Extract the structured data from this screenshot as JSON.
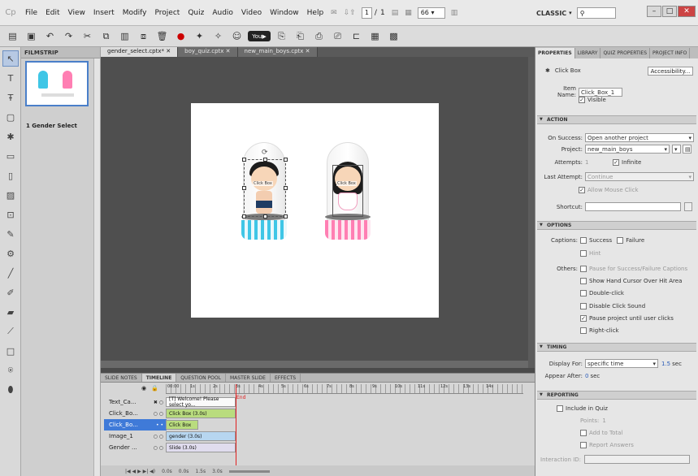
{
  "menubar": {
    "logo": "Cp",
    "items": [
      "File",
      "Edit",
      "View",
      "Insert",
      "Modify",
      "Project",
      "Quiz",
      "Audio",
      "Video",
      "Window",
      "Help"
    ],
    "page_current": "1",
    "page_sep": "/",
    "page_total": "1",
    "zoom": "66",
    "workspace": "CLASSIC",
    "search_icon": "search-icon"
  },
  "filmstrip": {
    "title": "FILMSTRIP",
    "slide_name": "1 Gender Select"
  },
  "doc_tabs": [
    "gender_select.cptx*",
    "boy_quiz.cptx",
    "new_main_boys.cptx"
  ],
  "stage": {
    "boy_label": "Click Box",
    "girl_label": "Click Box"
  },
  "timeline": {
    "tabs": [
      "SLIDE NOTES",
      "TIMELINE",
      "QUESTION POOL",
      "MASTER SLIDE",
      "EFFECTS"
    ],
    "ruler_labels": [
      "00:00",
      "1s",
      "2s",
      "3s",
      "4s",
      "5s",
      "6s",
      "7s",
      "8s",
      "9s",
      "10s",
      "11s",
      "12s",
      "13s",
      "14s"
    ],
    "end_label": "End",
    "layers": [
      {
        "name": "Text_Ca...",
        "icons": "✖ ○",
        "bar": "[T] Welcome! Please select yo..."
      },
      {
        "name": "Click_Bo...",
        "icons": "○ ○",
        "bar": "Click Box (3.0s)"
      },
      {
        "name": "Click_Bo...",
        "icons": "• •",
        "bar": "Click Box"
      },
      {
        "name": "Image_1",
        "icons": "○ ○",
        "bar": "gender (3.0s)"
      },
      {
        "name": "Gender ...",
        "icons": "○ ○",
        "bar": "Slide (3.0s)"
      }
    ],
    "controls": {
      "t1": "0.0s",
      "t2": "0.0s",
      "t3": "1.5s",
      "t4": "3.0s"
    }
  },
  "props": {
    "tabs": [
      "PROPERTIES",
      "LIBRARY",
      "QUIZ PROPERTIES",
      "PROJECT INFO"
    ],
    "object_type": "Click Box",
    "accessibility_btn": "Accessibility...",
    "item_name_label": "Item Name:",
    "item_name": "Click_Box_1",
    "visible_label": "Visible",
    "action": {
      "title": "ACTION",
      "on_success_label": "On Success:",
      "on_success": "Open another project",
      "project_label": "Project:",
      "project": "new_main_boys",
      "attempts_label": "Attempts:",
      "attempts": "1",
      "infinite_label": "Infinite",
      "last_attempt_label": "Last Attempt:",
      "last_attempt": "Continue",
      "allow_mouse": "Allow Mouse Click",
      "shortcut_label": "Shortcut:"
    },
    "options": {
      "title": "OPTIONS",
      "captions_label": "Captions:",
      "success": "Success",
      "failure": "Failure",
      "hint": "Hint",
      "others_label": "Others:",
      "pause_caption": "Pause for Success/Failure Captions",
      "hand_cursor": "Show Hand Cursor Over Hit Area",
      "double_click": "Double-click",
      "disable_sound": "Disable Click Sound",
      "pause_project": "Pause project until user clicks",
      "right_click": "Right-click"
    },
    "timing": {
      "title": "TIMING",
      "display_for_label": "Display For:",
      "display_for": "specific time",
      "display_value": "1.5",
      "display_unit": "sec",
      "appear_after_label": "Appear After:",
      "appear_value": "0",
      "appear_unit": "sec"
    },
    "reporting": {
      "title": "REPORTING",
      "include_quiz": "Include in Quiz",
      "points_label": "Points:",
      "points": "1",
      "add_total": "Add to Total",
      "report_answers": "Report Answers",
      "interaction_label": "Interaction ID:"
    }
  },
  "colors": {
    "accent": "#3f7ad8",
    "playhead": "#e02020"
  }
}
